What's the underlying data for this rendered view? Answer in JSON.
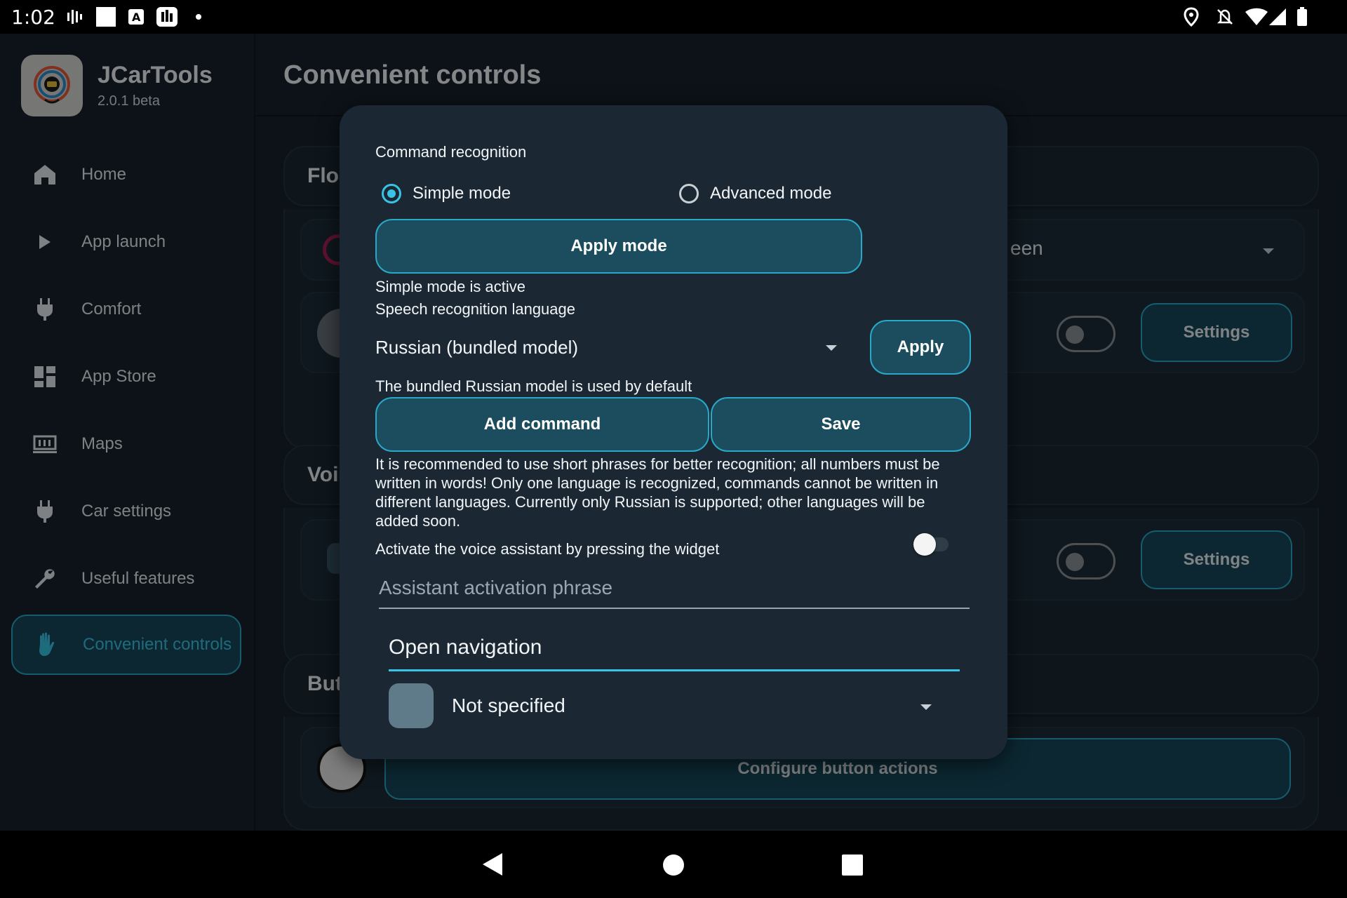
{
  "status_bar": {
    "time": "1:02"
  },
  "app": {
    "name": "JCarTools",
    "version": "2.0.1 beta"
  },
  "sidebar": {
    "items": [
      {
        "label": "Home",
        "icon": "home-icon"
      },
      {
        "label": "App launch",
        "icon": "play-icon"
      },
      {
        "label": "Comfort",
        "icon": "plug-icon"
      },
      {
        "label": "App Store",
        "icon": "dashboard-icon"
      },
      {
        "label": "Maps",
        "icon": "map-icon"
      },
      {
        "label": "Car settings",
        "icon": "plug-icon"
      },
      {
        "label": "Useful features",
        "icon": "wrench-icon"
      },
      {
        "label": "Convenient controls",
        "icon": "hand-icon",
        "active": true
      }
    ]
  },
  "main": {
    "title": "Convenient controls",
    "cards": {
      "floating_title": "Floa",
      "floating_select_value": "een",
      "floating_settings": "Settings",
      "voice_title": "Voi",
      "voice_settings": "Settings",
      "buttons_title": "But",
      "configure_button": "Configure button actions"
    }
  },
  "dialog": {
    "command_recognition_label": "Command recognition",
    "mode_simple": "Simple mode",
    "mode_advanced": "Advanced mode",
    "apply_mode_button": "Apply mode",
    "mode_status": "Simple mode is active",
    "language_label": "Speech recognition language",
    "language_value": "Russian (bundled model)",
    "apply_button": "Apply",
    "language_hint": "The bundled Russian model is used by default",
    "add_command_button": "Add command",
    "save_button": "Save",
    "recommendation": "It is recommended to use short phrases for better recognition; all numbers must be written in words! Only one language is recognized, commands cannot be written in different languages. Currently only Russian is supported; other languages will be added soon.",
    "activate_label": "Activate the voice assistant by pressing the widget",
    "activation_phrase_placeholder": "Assistant activation phrase",
    "command_text_value": "Open navigation",
    "action_value": "Not specified"
  },
  "colors": {
    "accent": "#39c4e6",
    "button_fill": "#1b4d5f",
    "dialog_bg": "#1b2733"
  }
}
